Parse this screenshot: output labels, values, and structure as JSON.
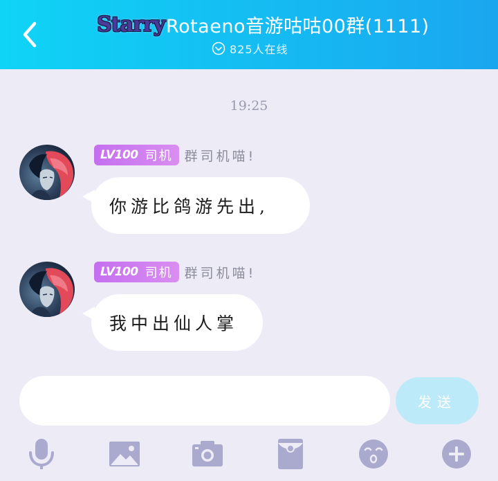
{
  "header": {
    "group_logo": "Starry",
    "group_title": "Rotaeno音游咕咕00群(1111)",
    "online_count_text": "825人在线"
  },
  "chat": {
    "timestamp": "19:25",
    "messages": [
      {
        "level_badge": "LV100",
        "role": "司机",
        "nickname": "群司机喵!",
        "text": "你游比鸽游先出,"
      },
      {
        "level_badge": "LV100",
        "role": "司机",
        "nickname": "群司机喵!",
        "text": "我中出仙人掌"
      }
    ]
  },
  "composer": {
    "input_value": "",
    "send_label": "发送"
  },
  "toolbar": {
    "icons": [
      "microphone-icon",
      "image-icon",
      "camera-icon",
      "red-packet-icon",
      "emoji-icon",
      "plus-icon"
    ]
  },
  "colors": {
    "header_gradient_start": "#0fd4f6",
    "header_gradient_end": "#1aa6ef",
    "background": "#ecebf6",
    "badge_purple": "#c56ff0",
    "toolbar_icon": "#aaaacf",
    "send_button": "#bdeaf9"
  }
}
